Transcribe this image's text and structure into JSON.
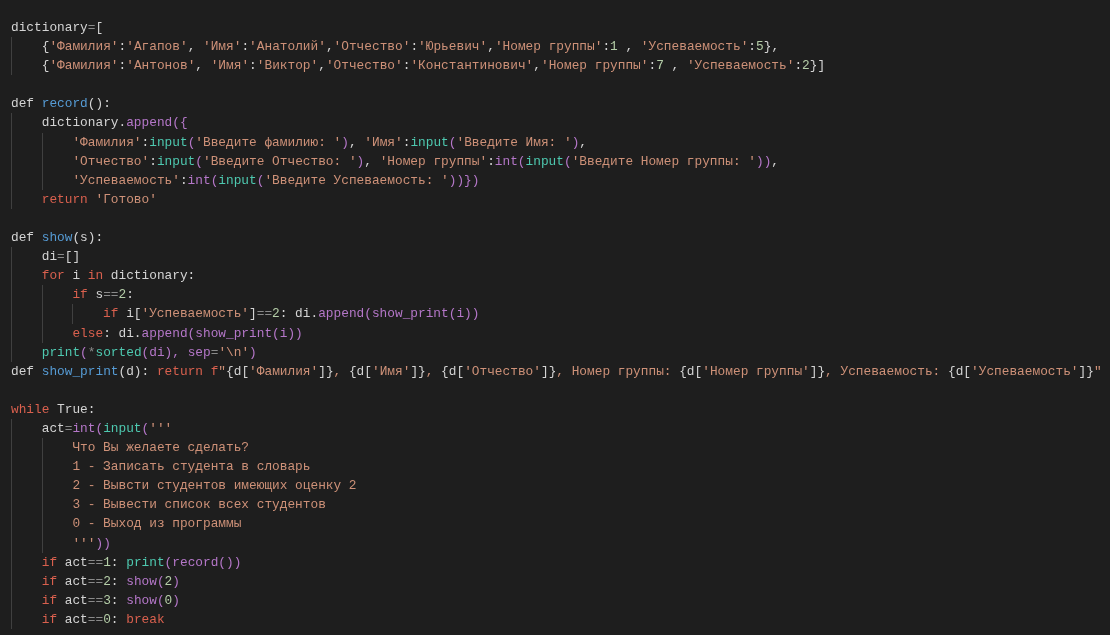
{
  "editor": {
    "blocks": [
      {
        "lines": [
          {
            "tokens": [
              {
                "kind": "text",
                "text": "dictionary"
              },
              {
                "kind": "operator",
                "text": "="
              },
              {
                "kind": "text",
                "text": "["
              }
            ],
            "children": [
              {
                "tokens": [
                  {
                    "kind": "text",
                    "text": "{"
                  },
                  {
                    "kind": "string",
                    "text": "'Фамилия'"
                  },
                  {
                    "kind": "text",
                    "text": ":"
                  },
                  {
                    "kind": "string",
                    "text": "'Агапов'"
                  },
                  {
                    "kind": "text",
                    "text": ", "
                  },
                  {
                    "kind": "string",
                    "text": "'Имя'"
                  },
                  {
                    "kind": "text",
                    "text": ":"
                  },
                  {
                    "kind": "string",
                    "text": "'Анатолий'"
                  },
                  {
                    "kind": "text",
                    "text": ","
                  },
                  {
                    "kind": "string",
                    "text": "'Отчество'"
                  },
                  {
                    "kind": "text",
                    "text": ":"
                  },
                  {
                    "kind": "string",
                    "text": "'Юрьевич'"
                  },
                  {
                    "kind": "text",
                    "text": ","
                  },
                  {
                    "kind": "string",
                    "text": "'Номер группы'"
                  },
                  {
                    "kind": "text",
                    "text": ":"
                  },
                  {
                    "kind": "number",
                    "text": "1"
                  },
                  {
                    "kind": "text",
                    "text": " , "
                  },
                  {
                    "kind": "string",
                    "text": "'Успеваемость'"
                  },
                  {
                    "kind": "text",
                    "text": ":"
                  },
                  {
                    "kind": "number",
                    "text": "5"
                  },
                  {
                    "kind": "text",
                    "text": "},"
                  }
                ]
              },
              {
                "tokens": [
                  {
                    "kind": "text",
                    "text": "{"
                  },
                  {
                    "kind": "string",
                    "text": "'Фамилия'"
                  },
                  {
                    "kind": "text",
                    "text": ":"
                  },
                  {
                    "kind": "string",
                    "text": "'Антонов'"
                  },
                  {
                    "kind": "text",
                    "text": ", "
                  },
                  {
                    "kind": "string",
                    "text": "'Имя'"
                  },
                  {
                    "kind": "text",
                    "text": ":"
                  },
                  {
                    "kind": "string",
                    "text": "'Виктор'"
                  },
                  {
                    "kind": "text",
                    "text": ","
                  },
                  {
                    "kind": "string",
                    "text": "'Отчество'"
                  },
                  {
                    "kind": "text",
                    "text": ":"
                  },
                  {
                    "kind": "string",
                    "text": "'Константинович'"
                  },
                  {
                    "kind": "text",
                    "text": ","
                  },
                  {
                    "kind": "string",
                    "text": "'Номер группы'"
                  },
                  {
                    "kind": "text",
                    "text": ":"
                  },
                  {
                    "kind": "number",
                    "text": "7"
                  },
                  {
                    "kind": "text",
                    "text": " , "
                  },
                  {
                    "kind": "string",
                    "text": "'Успеваемость'"
                  },
                  {
                    "kind": "text",
                    "text": ":"
                  },
                  {
                    "kind": "number",
                    "text": "2"
                  },
                  {
                    "kind": "text",
                    "text": "}]"
                  }
                ]
              }
            ]
          }
        ]
      },
      {
        "lines": [
          {
            "tokens": [
              {
                "kind": "text",
                "text": "def "
              },
              {
                "kind": "function",
                "text": "record"
              },
              {
                "kind": "text",
                "text": "():"
              }
            ],
            "children": [
              {
                "tokens": [
                  {
                    "kind": "text",
                    "text": "dictionary."
                  },
                  {
                    "kind": "call",
                    "text": "append({"
                  }
                ],
                "children": [
                  {
                    "tokens": [
                      {
                        "kind": "string",
                        "text": "'Фамилия'"
                      },
                      {
                        "kind": "text",
                        "text": ":"
                      },
                      {
                        "kind": "builtin",
                        "text": "input"
                      },
                      {
                        "kind": "call",
                        "text": "("
                      },
                      {
                        "kind": "string",
                        "text": "'Введите фамилию: '"
                      },
                      {
                        "kind": "call",
                        "text": ")"
                      },
                      {
                        "kind": "text",
                        "text": ", "
                      },
                      {
                        "kind": "string",
                        "text": "'Имя'"
                      },
                      {
                        "kind": "text",
                        "text": ":"
                      },
                      {
                        "kind": "builtin",
                        "text": "input"
                      },
                      {
                        "kind": "call",
                        "text": "("
                      },
                      {
                        "kind": "string",
                        "text": "'Введите Имя: '"
                      },
                      {
                        "kind": "call",
                        "text": ")"
                      },
                      {
                        "kind": "text",
                        "text": ","
                      }
                    ]
                  },
                  {
                    "tokens": [
                      {
                        "kind": "string",
                        "text": "'Отчество'"
                      },
                      {
                        "kind": "text",
                        "text": ":"
                      },
                      {
                        "kind": "builtin",
                        "text": "input"
                      },
                      {
                        "kind": "call",
                        "text": "("
                      },
                      {
                        "kind": "string",
                        "text": "'Введите Отчество: '"
                      },
                      {
                        "kind": "call",
                        "text": ")"
                      },
                      {
                        "kind": "text",
                        "text": ", "
                      },
                      {
                        "kind": "string",
                        "text": "'Номер группы'"
                      },
                      {
                        "kind": "text",
                        "text": ":"
                      },
                      {
                        "kind": "call",
                        "text": "int("
                      },
                      {
                        "kind": "builtin",
                        "text": "input"
                      },
                      {
                        "kind": "call",
                        "text": "("
                      },
                      {
                        "kind": "string",
                        "text": "'Введите Номер группы: '"
                      },
                      {
                        "kind": "call",
                        "text": "))"
                      },
                      {
                        "kind": "text",
                        "text": ","
                      }
                    ]
                  },
                  {
                    "tokens": [
                      {
                        "kind": "string",
                        "text": "'Успеваемость'"
                      },
                      {
                        "kind": "text",
                        "text": ":"
                      },
                      {
                        "kind": "call",
                        "text": "int("
                      },
                      {
                        "kind": "builtin",
                        "text": "input"
                      },
                      {
                        "kind": "call",
                        "text": "("
                      },
                      {
                        "kind": "string",
                        "text": "'Введите Успеваемость: '"
                      },
                      {
                        "kind": "call",
                        "text": "))})"
                      }
                    ]
                  }
                ]
              },
              {
                "tokens": [
                  {
                    "kind": "keyword",
                    "text": "return "
                  },
                  {
                    "kind": "string",
                    "text": "'Готово'"
                  }
                ]
              }
            ]
          }
        ]
      },
      {
        "lines": [
          {
            "tokens": [
              {
                "kind": "text",
                "text": "def "
              },
              {
                "kind": "function",
                "text": "show"
              },
              {
                "kind": "text",
                "text": "(s):"
              }
            ],
            "children": [
              {
                "tokens": [
                  {
                    "kind": "text",
                    "text": "di"
                  },
                  {
                    "kind": "operator",
                    "text": "="
                  },
                  {
                    "kind": "text",
                    "text": "[]"
                  }
                ]
              },
              {
                "tokens": [
                  {
                    "kind": "keyword",
                    "text": "for "
                  },
                  {
                    "kind": "text",
                    "text": "i "
                  },
                  {
                    "kind": "keyword",
                    "text": "in "
                  },
                  {
                    "kind": "text",
                    "text": "dictionary:"
                  }
                ],
                "children": [
                  {
                    "tokens": [
                      {
                        "kind": "keyword",
                        "text": "if "
                      },
                      {
                        "kind": "text",
                        "text": "s"
                      },
                      {
                        "kind": "operator",
                        "text": "=="
                      },
                      {
                        "kind": "number",
                        "text": "2"
                      },
                      {
                        "kind": "text",
                        "text": ":"
                      }
                    ],
                    "children": [
                      {
                        "tokens": [
                          {
                            "kind": "keyword",
                            "text": "if "
                          },
                          {
                            "kind": "text",
                            "text": "i["
                          },
                          {
                            "kind": "string",
                            "text": "'Успеваемость'"
                          },
                          {
                            "kind": "text",
                            "text": "]"
                          },
                          {
                            "kind": "operator",
                            "text": "=="
                          },
                          {
                            "kind": "number",
                            "text": "2"
                          },
                          {
                            "kind": "text",
                            "text": ": di."
                          },
                          {
                            "kind": "call",
                            "text": "append(show_print(i))"
                          }
                        ]
                      }
                    ]
                  },
                  {
                    "tokens": [
                      {
                        "kind": "keyword",
                        "text": "else"
                      },
                      {
                        "kind": "text",
                        "text": ": di."
                      },
                      {
                        "kind": "call",
                        "text": "append(show_print(i))"
                      }
                    ]
                  }
                ]
              },
              {
                "tokens": [
                  {
                    "kind": "builtin",
                    "text": "print"
                  },
                  {
                    "kind": "call",
                    "text": "("
                  },
                  {
                    "kind": "operator",
                    "text": "*"
                  },
                  {
                    "kind": "builtin",
                    "text": "sorted"
                  },
                  {
                    "kind": "call",
                    "text": "(di), sep"
                  },
                  {
                    "kind": "operator",
                    "text": "="
                  },
                  {
                    "kind": "string",
                    "text": "'\\n'"
                  },
                  {
                    "kind": "call",
                    "text": ")"
                  }
                ]
              }
            ]
          },
          {
            "tokens": [
              {
                "kind": "text",
                "text": "def "
              },
              {
                "kind": "function",
                "text": "show_print"
              },
              {
                "kind": "text",
                "text": "(d): "
              },
              {
                "kind": "keyword",
                "text": "return f"
              },
              {
                "kind": "string",
                "text": "\""
              },
              {
                "kind": "text",
                "text": "{d["
              },
              {
                "kind": "string",
                "text": "'Фамилия'"
              },
              {
                "kind": "text",
                "text": "]}"
              },
              {
                "kind": "string",
                "text": ", "
              },
              {
                "kind": "text",
                "text": "{d["
              },
              {
                "kind": "string",
                "text": "'Имя'"
              },
              {
                "kind": "text",
                "text": "]}"
              },
              {
                "kind": "string",
                "text": ", "
              },
              {
                "kind": "text",
                "text": "{d["
              },
              {
                "kind": "string",
                "text": "'Отчество'"
              },
              {
                "kind": "text",
                "text": "]}"
              },
              {
                "kind": "string",
                "text": ", Номер группы: "
              },
              {
                "kind": "text",
                "text": "{d["
              },
              {
                "kind": "string",
                "text": "'Номер группы'"
              },
              {
                "kind": "text",
                "text": "]}"
              },
              {
                "kind": "string",
                "text": ", Успеваемость: "
              },
              {
                "kind": "text",
                "text": "{d["
              },
              {
                "kind": "string",
                "text": "'Успеваемость'"
              },
              {
                "kind": "text",
                "text": "]}"
              },
              {
                "kind": "string",
                "text": "\""
              }
            ]
          }
        ]
      },
      {
        "lines": [
          {
            "tokens": [
              {
                "kind": "keyword",
                "text": "while "
              },
              {
                "kind": "text",
                "text": "True:"
              }
            ],
            "children": [
              {
                "tokens": [
                  {
                    "kind": "text",
                    "text": "act"
                  },
                  {
                    "kind": "operator",
                    "text": "="
                  },
                  {
                    "kind": "call",
                    "text": "int("
                  },
                  {
                    "kind": "builtin",
                    "text": "input"
                  },
                  {
                    "kind": "call",
                    "text": "("
                  },
                  {
                    "kind": "string",
                    "text": "'''"
                  }
                ],
                "children": [
                  {
                    "tokens": [
                      {
                        "kind": "string",
                        "text": "Что Вы желаете сделать?"
                      }
                    ]
                  },
                  {
                    "tokens": [
                      {
                        "kind": "string",
                        "text": "1 - Записать студента в словарь"
                      }
                    ]
                  },
                  {
                    "tokens": [
                      {
                        "kind": "string",
                        "text": "2 - Вывсти студентов имеющих оценку 2"
                      }
                    ]
                  },
                  {
                    "tokens": [
                      {
                        "kind": "string",
                        "text": "3 - Вывести список всех студентов"
                      }
                    ]
                  },
                  {
                    "tokens": [
                      {
                        "kind": "string",
                        "text": "0 - Выход из программы"
                      }
                    ]
                  },
                  {
                    "tokens": [
                      {
                        "kind": "string",
                        "text": "'''"
                      },
                      {
                        "kind": "call",
                        "text": "))"
                      }
                    ]
                  }
                ]
              },
              {
                "tokens": [
                  {
                    "kind": "keyword",
                    "text": "if "
                  },
                  {
                    "kind": "text",
                    "text": "act"
                  },
                  {
                    "kind": "operator",
                    "text": "=="
                  },
                  {
                    "kind": "number",
                    "text": "1"
                  },
                  {
                    "kind": "text",
                    "text": ": "
                  },
                  {
                    "kind": "builtin",
                    "text": "print"
                  },
                  {
                    "kind": "call",
                    "text": "(record())"
                  }
                ]
              },
              {
                "tokens": [
                  {
                    "kind": "keyword",
                    "text": "if "
                  },
                  {
                    "kind": "text",
                    "text": "act"
                  },
                  {
                    "kind": "operator",
                    "text": "=="
                  },
                  {
                    "kind": "number",
                    "text": "2"
                  },
                  {
                    "kind": "text",
                    "text": ": "
                  },
                  {
                    "kind": "call",
                    "text": "show("
                  },
                  {
                    "kind": "number",
                    "text": "2"
                  },
                  {
                    "kind": "call",
                    "text": ")"
                  }
                ]
              },
              {
                "tokens": [
                  {
                    "kind": "keyword",
                    "text": "if "
                  },
                  {
                    "kind": "text",
                    "text": "act"
                  },
                  {
                    "kind": "operator",
                    "text": "=="
                  },
                  {
                    "kind": "number",
                    "text": "3"
                  },
                  {
                    "kind": "text",
                    "text": ": "
                  },
                  {
                    "kind": "call",
                    "text": "show("
                  },
                  {
                    "kind": "number",
                    "text": "0"
                  },
                  {
                    "kind": "call",
                    "text": ")"
                  }
                ]
              },
              {
                "tokens": [
                  {
                    "kind": "keyword",
                    "text": "if "
                  },
                  {
                    "kind": "text",
                    "text": "act"
                  },
                  {
                    "kind": "operator",
                    "text": "=="
                  },
                  {
                    "kind": "number",
                    "text": "0"
                  },
                  {
                    "kind": "text",
                    "text": ": "
                  },
                  {
                    "kind": "keyword",
                    "text": "break"
                  }
                ]
              }
            ]
          }
        ]
      }
    ]
  }
}
